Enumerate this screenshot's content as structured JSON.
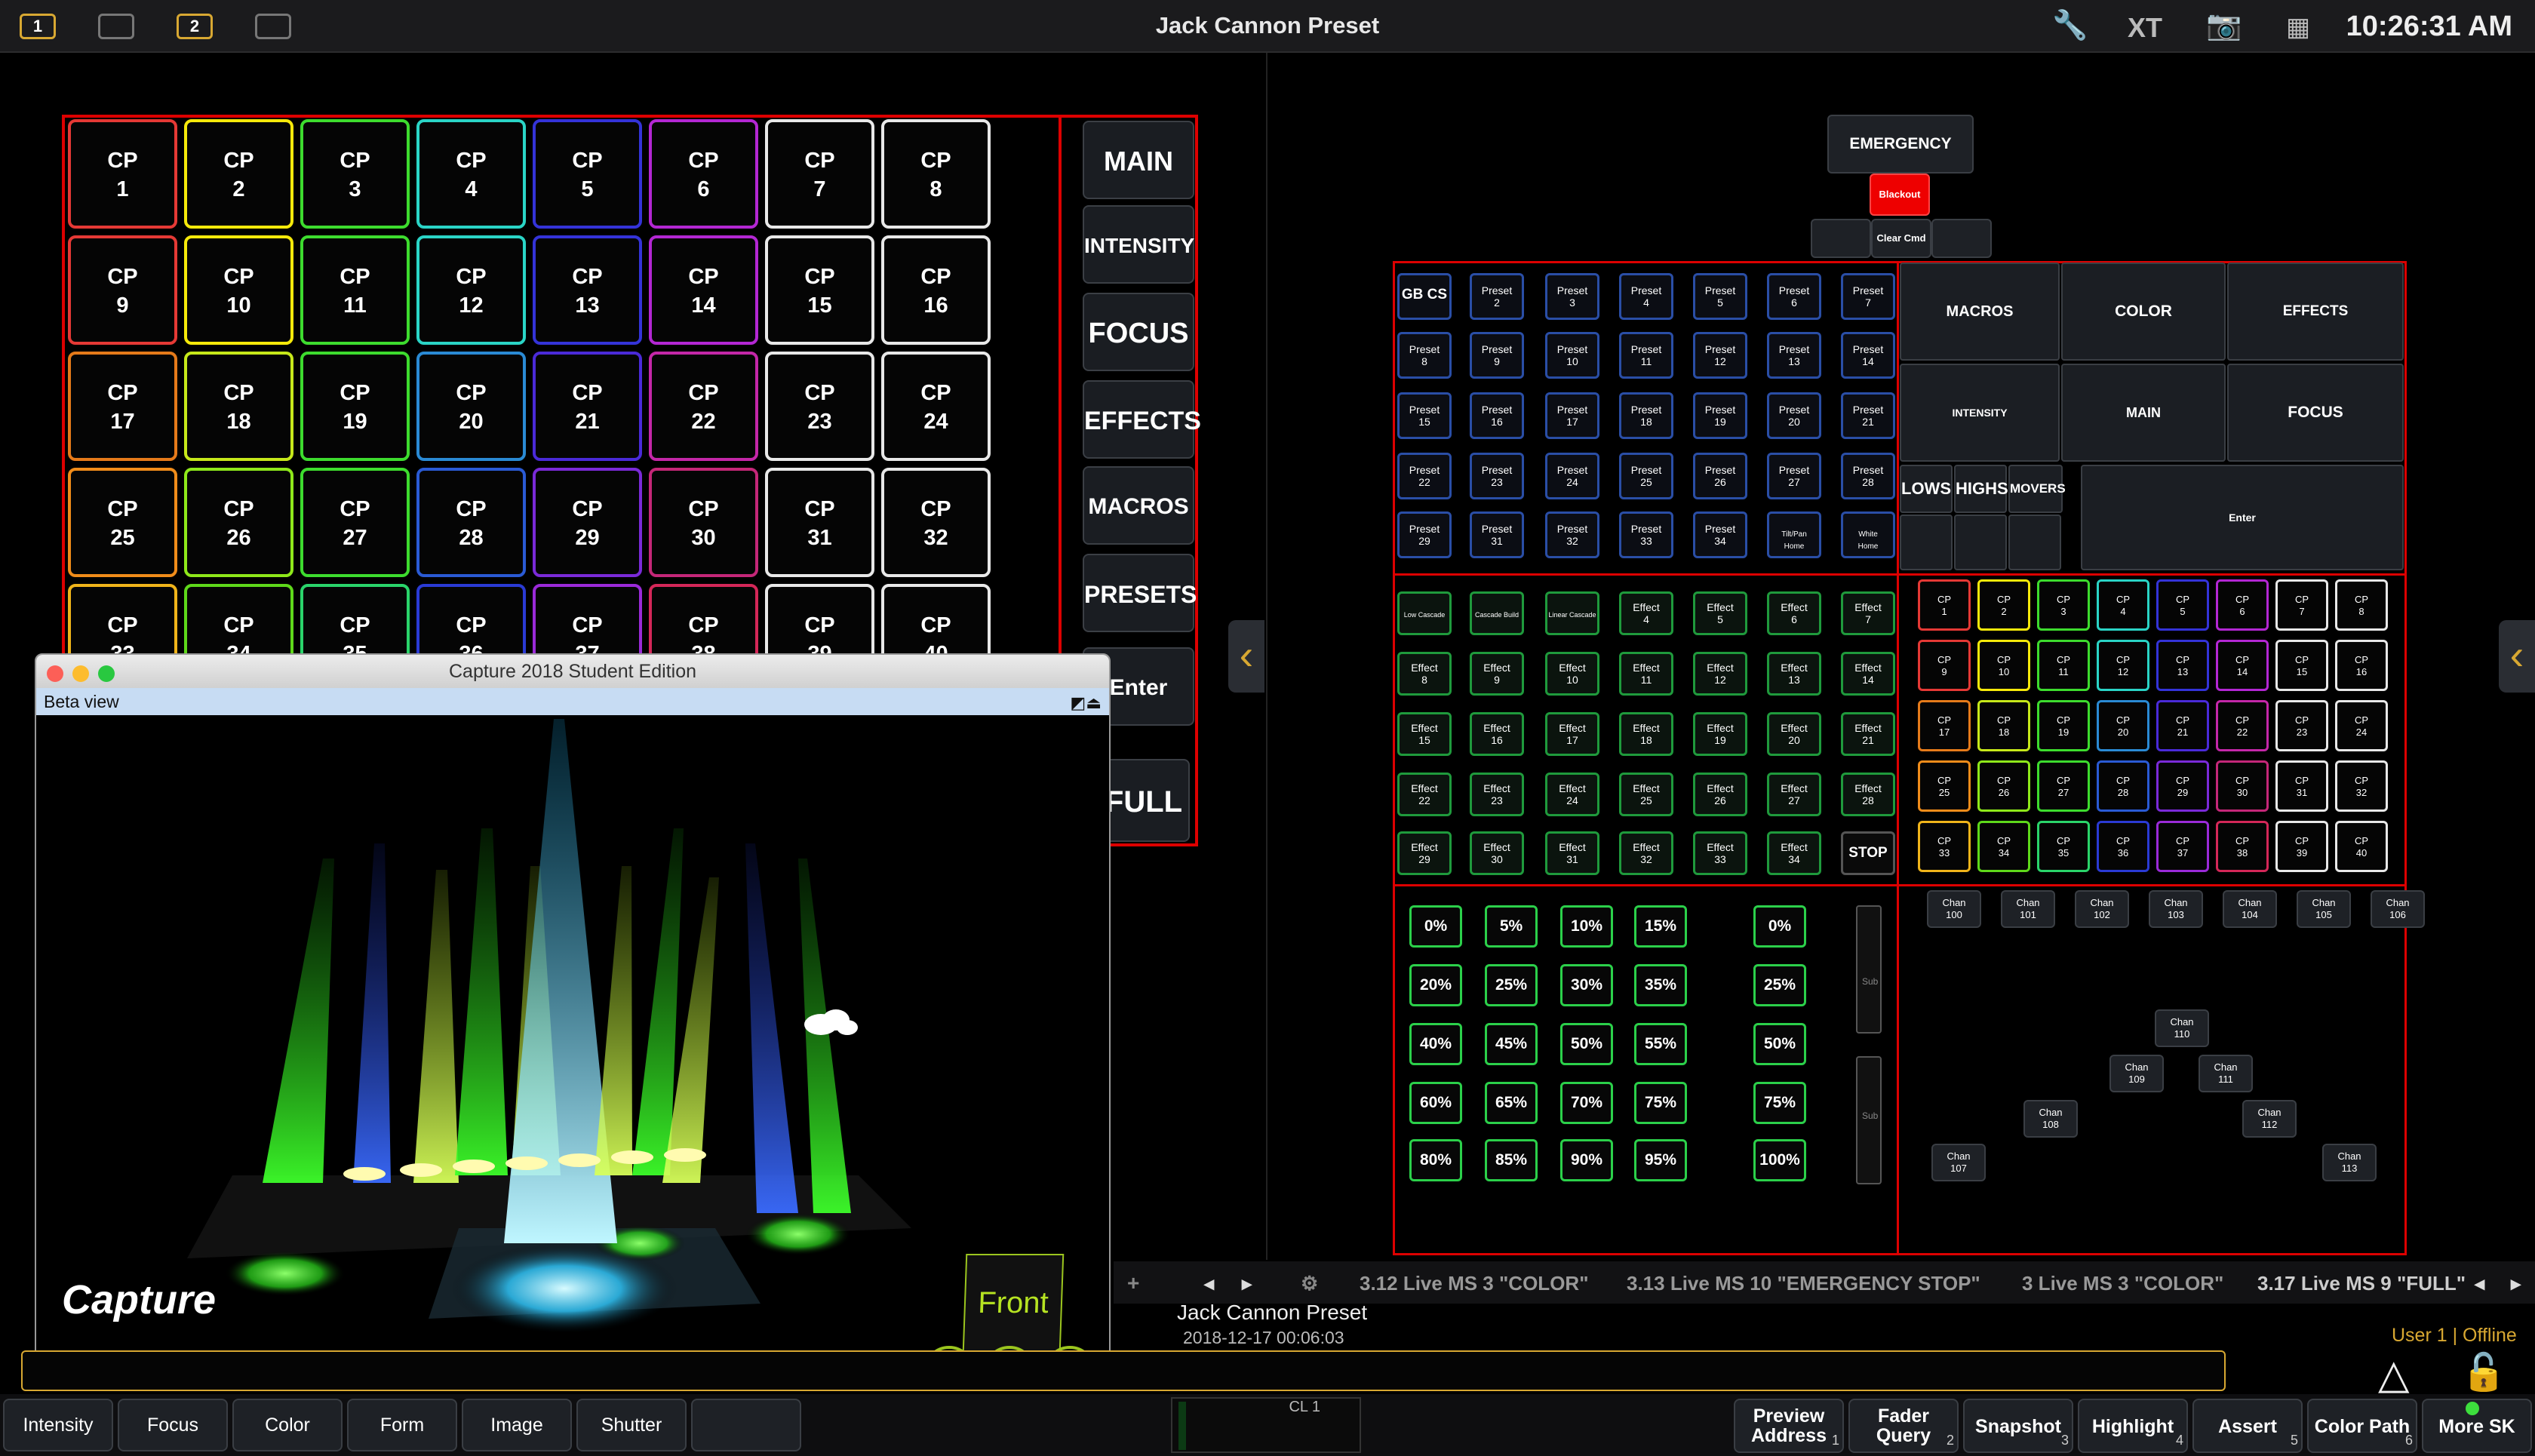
{
  "topbar": {
    "title": "Jack Cannon Preset",
    "workspace_1": "1",
    "workspace_2": "2",
    "clock": "10:26:31 AM"
  },
  "left_grid": {
    "buttons": [
      "CP 1",
      "CP 2",
      "CP 3",
      "CP 4",
      "CP 5",
      "CP 6",
      "CP 7",
      "CP 8",
      "CP 9",
      "CP 10",
      "CP 11",
      "CP 12",
      "CP 13",
      "CP 14",
      "CP 15",
      "CP 16",
      "CP 17",
      "CP 18",
      "CP 19",
      "CP 20",
      "CP 21",
      "CP 22",
      "CP 23",
      "CP 24",
      "CP 25",
      "CP 26",
      "CP 27",
      "CP 28",
      "CP 29",
      "CP 30",
      "CP 31",
      "CP 32",
      "CP 33",
      "CP 34",
      "CP 35",
      "CP 36",
      "CP 37",
      "CP 38",
      "CP 39",
      "CP 40"
    ],
    "column_colors": [
      "#e53935",
      "#f5e90a",
      "#3ddc2e",
      "#2ad4c6",
      "#3433d8",
      "#b327d3",
      "#e8e8e8",
      "#e8e8e8"
    ],
    "row_overrides": {
      "0": [
        "#e53935",
        "#f5e90a",
        "#3ddc2e",
        "#2ad4c6",
        "#3433d8",
        "#b327d3",
        "#e8e8e8",
        "#e8e8e8"
      ]
    }
  },
  "sidebar": [
    "MAIN",
    "INTENSITY",
    "FOCUS",
    "EFFECTS",
    "MACROS",
    "PRESETS",
    "Enter",
    "FULL"
  ],
  "right": {
    "emergency": "EMERGENCY",
    "blackout": "Blackout",
    "clear_cmd": "Clear Cmd",
    "presets": [
      "GB CS",
      "Preset 2",
      "Preset 3",
      "Preset 4",
      "Preset 5",
      "Preset 6",
      "Preset 7",
      "Preset 8",
      "Preset 9",
      "Preset 10",
      "Preset 11",
      "Preset 12",
      "Preset 13",
      "Preset 14",
      "Preset 15",
      "Preset 16",
      "Preset 17",
      "Preset 18",
      "Preset 19",
      "Preset 20",
      "Preset 21",
      "Preset 22",
      "Preset 23",
      "Preset 24",
      "Preset 25",
      "Preset 26",
      "Preset 27",
      "Preset 28",
      "Preset 29",
      "Preset 31",
      "Preset 32",
      "Preset 33",
      "Preset 34",
      "Tilt/Pan Home",
      "White Home"
    ],
    "nav": [
      "MACROS",
      "COLOR",
      "EFFECTS",
      "INTENSITY",
      "MAIN",
      "FOCUS",
      "LOWS",
      "HIGHS",
      "MOVERS",
      "Enter"
    ],
    "effects": [
      "Low Cascade",
      "Cascade Build",
      "Linear Cascade",
      "Effect 4",
      "Effect 5",
      "Effect 6",
      "Effect 7",
      "Effect 8",
      "Effect 9",
      "Effect 10",
      "Effect 11",
      "Effect 12",
      "Effect 13",
      "Effect 14",
      "Effect 15",
      "Effect 16",
      "Effect 17",
      "Effect 18",
      "Effect 19",
      "Effect 20",
      "Effect 21",
      "Effect 22",
      "Effect 23",
      "Effect 24",
      "Effect 25",
      "Effect 26",
      "Effect 27",
      "Effect 28",
      "Effect 29",
      "Effect 30",
      "Effect 31",
      "Effect 32",
      "Effect 33",
      "Effect 34",
      "STOP"
    ],
    "mini_cp": [
      "CP 1",
      "CP 2",
      "CP 3",
      "CP 4",
      "CP 5",
      "CP 6",
      "CP 7",
      "CP 8",
      "CP 9",
      "CP 10",
      "CP 11",
      "CP 12",
      "CP 13",
      "CP 14",
      "CP 15",
      "CP 16",
      "CP 17",
      "CP 18",
      "CP 19",
      "CP 20",
      "CP 21",
      "CP 22",
      "CP 23",
      "CP 24",
      "CP 25",
      "CP 26",
      "CP 27",
      "CP 28",
      "CP 29",
      "CP 30",
      "CP 31",
      "CP 32",
      "CP 33",
      "CP 34",
      "CP 35",
      "CP 36",
      "CP 37",
      "CP 38",
      "CP 39",
      "CP 40"
    ],
    "levels": [
      "0%",
      "5%",
      "10%",
      "15%",
      "20%",
      "25%",
      "30%",
      "35%",
      "40%",
      "45%",
      "50%",
      "55%",
      "60%",
      "65%",
      "70%",
      "75%",
      "80%",
      "85%",
      "90%",
      "95%"
    ],
    "levels2": [
      "0%",
      "25%",
      "50%",
      "75%",
      "100%"
    ],
    "sub_label": "Sub",
    "chan_row": [
      "Chan 100",
      "Chan 101",
      "Chan 102",
      "Chan 103",
      "Chan 104",
      "Chan 105",
      "Chan 106"
    ],
    "chan_tree": [
      "Chan 110",
      "Chan 109",
      "Chan 111",
      "Chan 108",
      "Chan 112",
      "Chan 107",
      "Chan 113"
    ]
  },
  "capture": {
    "window_title": "Capture 2018 Student Edition",
    "view_name": "Beta view",
    "front_label": "Front",
    "logo": "Capture"
  },
  "tabs": [
    "3.12 Live MS 3 \"COLOR\"",
    "3.13 Live MS 10 \"EMERGENCY STOP\"",
    "3 Live MS 3 \"COLOR\"",
    "3.17 Live MS 9 \"FULL\""
  ],
  "show": {
    "name": "Jack Cannon Preset",
    "date": "2018-12-17 00:06:03"
  },
  "status": {
    "user": "User 1 | Offline",
    "cue_list": "CL 1"
  },
  "bottom_tabs": [
    "Intensity",
    "Focus",
    "Color",
    "Form",
    "Image",
    "Shutter",
    ""
  ],
  "softkeys": [
    {
      "label": "Preview Address",
      "num": "1"
    },
    {
      "label": "Fader Query",
      "num": "2"
    },
    {
      "label": "Snapshot",
      "num": "3"
    },
    {
      "label": "Highlight",
      "num": "4"
    },
    {
      "label": "Assert",
      "num": "5"
    },
    {
      "label": "Color Path",
      "num": "6"
    },
    {
      "label": "More SK",
      "num": ""
    }
  ],
  "colors": {
    "accent": "#d8a832",
    "red_border": "#dd0000",
    "preset_blue": "#2a4ea6",
    "effect_green": "#1f9a3c"
  }
}
